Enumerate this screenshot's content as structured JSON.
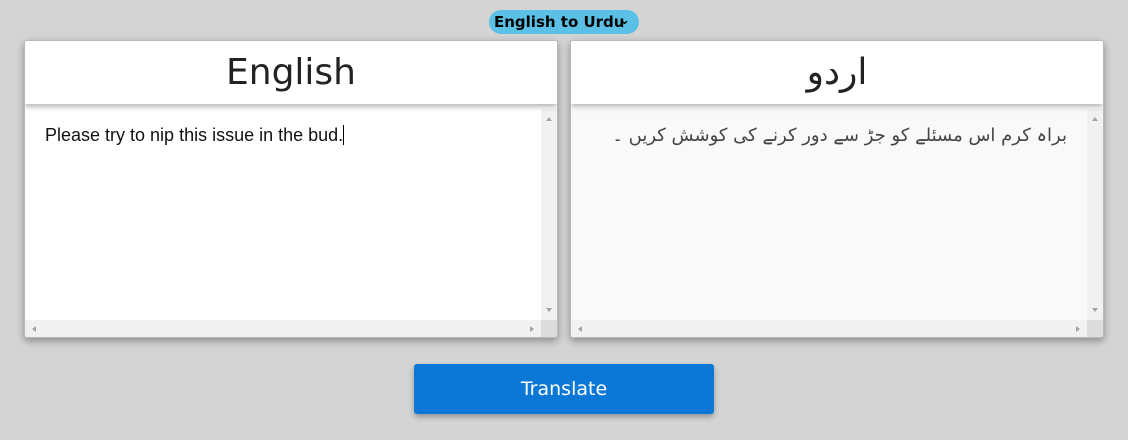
{
  "language_select": {
    "selected": "English to Urdu",
    "chevron_icon": "chevron-down-icon"
  },
  "source_panel": {
    "title": "English",
    "text": "Please try to nip this issue in the bud."
  },
  "target_panel": {
    "title": "اردو",
    "text": "براہ کرم اس مسئلے کو جڑ سے دور کرنے کی کوشش کریں ۔"
  },
  "actions": {
    "translate_label": "Translate"
  },
  "colors": {
    "background": "#d4d4d4",
    "select_bg": "#5bc0e6",
    "button_bg": "#0b78d8"
  }
}
